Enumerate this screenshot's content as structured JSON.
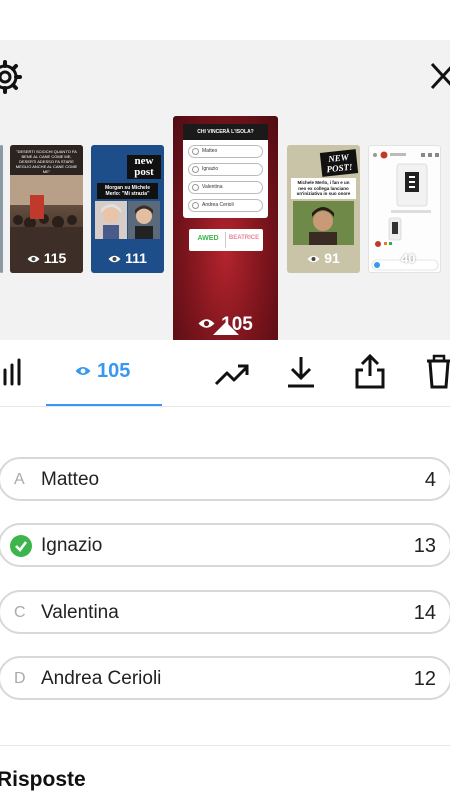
{
  "header": {
    "settings_icon": "gear-icon",
    "close_icon": "close-icon"
  },
  "stories": [
    {
      "caption": "\"DESERTI SCIOCHI QUANTO FA BENE AL CANE COME ME, DESERTI ADESSO FA STARE MEGLIO ANCHE AL CANE COME ME\"",
      "views": "115"
    },
    {
      "badge": "new post",
      "caption": "Morgan su Michele Merlo: \"Mi strazia\"",
      "views": "111"
    },
    {
      "poll_title": "CHI VINCERÀ L'ISOLA?",
      "poll_options": [
        "Matteo",
        "Ignazio",
        "Valentina",
        "Andrea Cerioli"
      ],
      "left_label": "AWED",
      "right_label": "BEATRICE",
      "views": "105"
    },
    {
      "badge": "NEW POST!",
      "caption": "Michele Merlo, i fan e un neo ex collega lanciano un'iniziativa in suo onore",
      "views": "91"
    },
    {
      "views": "40"
    }
  ],
  "tabs": {
    "insights_icon": "bar-chart-icon",
    "viewers_count": "105",
    "promote_icon": "trending-up-icon",
    "download_icon": "download-icon",
    "share_icon": "share-icon",
    "delete_icon": "trash-icon"
  },
  "poll_results": [
    {
      "letter": "A",
      "name": "Matteo",
      "count": "4",
      "correct": false
    },
    {
      "letter": "",
      "name": "Ignazio",
      "count": "13",
      "correct": true
    },
    {
      "letter": "C",
      "name": "Valentina",
      "count": "14",
      "correct": false
    },
    {
      "letter": "D",
      "name": "Andrea Cerioli",
      "count": "12",
      "correct": false
    }
  ],
  "responses": {
    "title": "Risposte"
  },
  "colors": {
    "accent": "#3897f0",
    "correct": "#3cb54a",
    "poll_background": "#8b1a24"
  }
}
